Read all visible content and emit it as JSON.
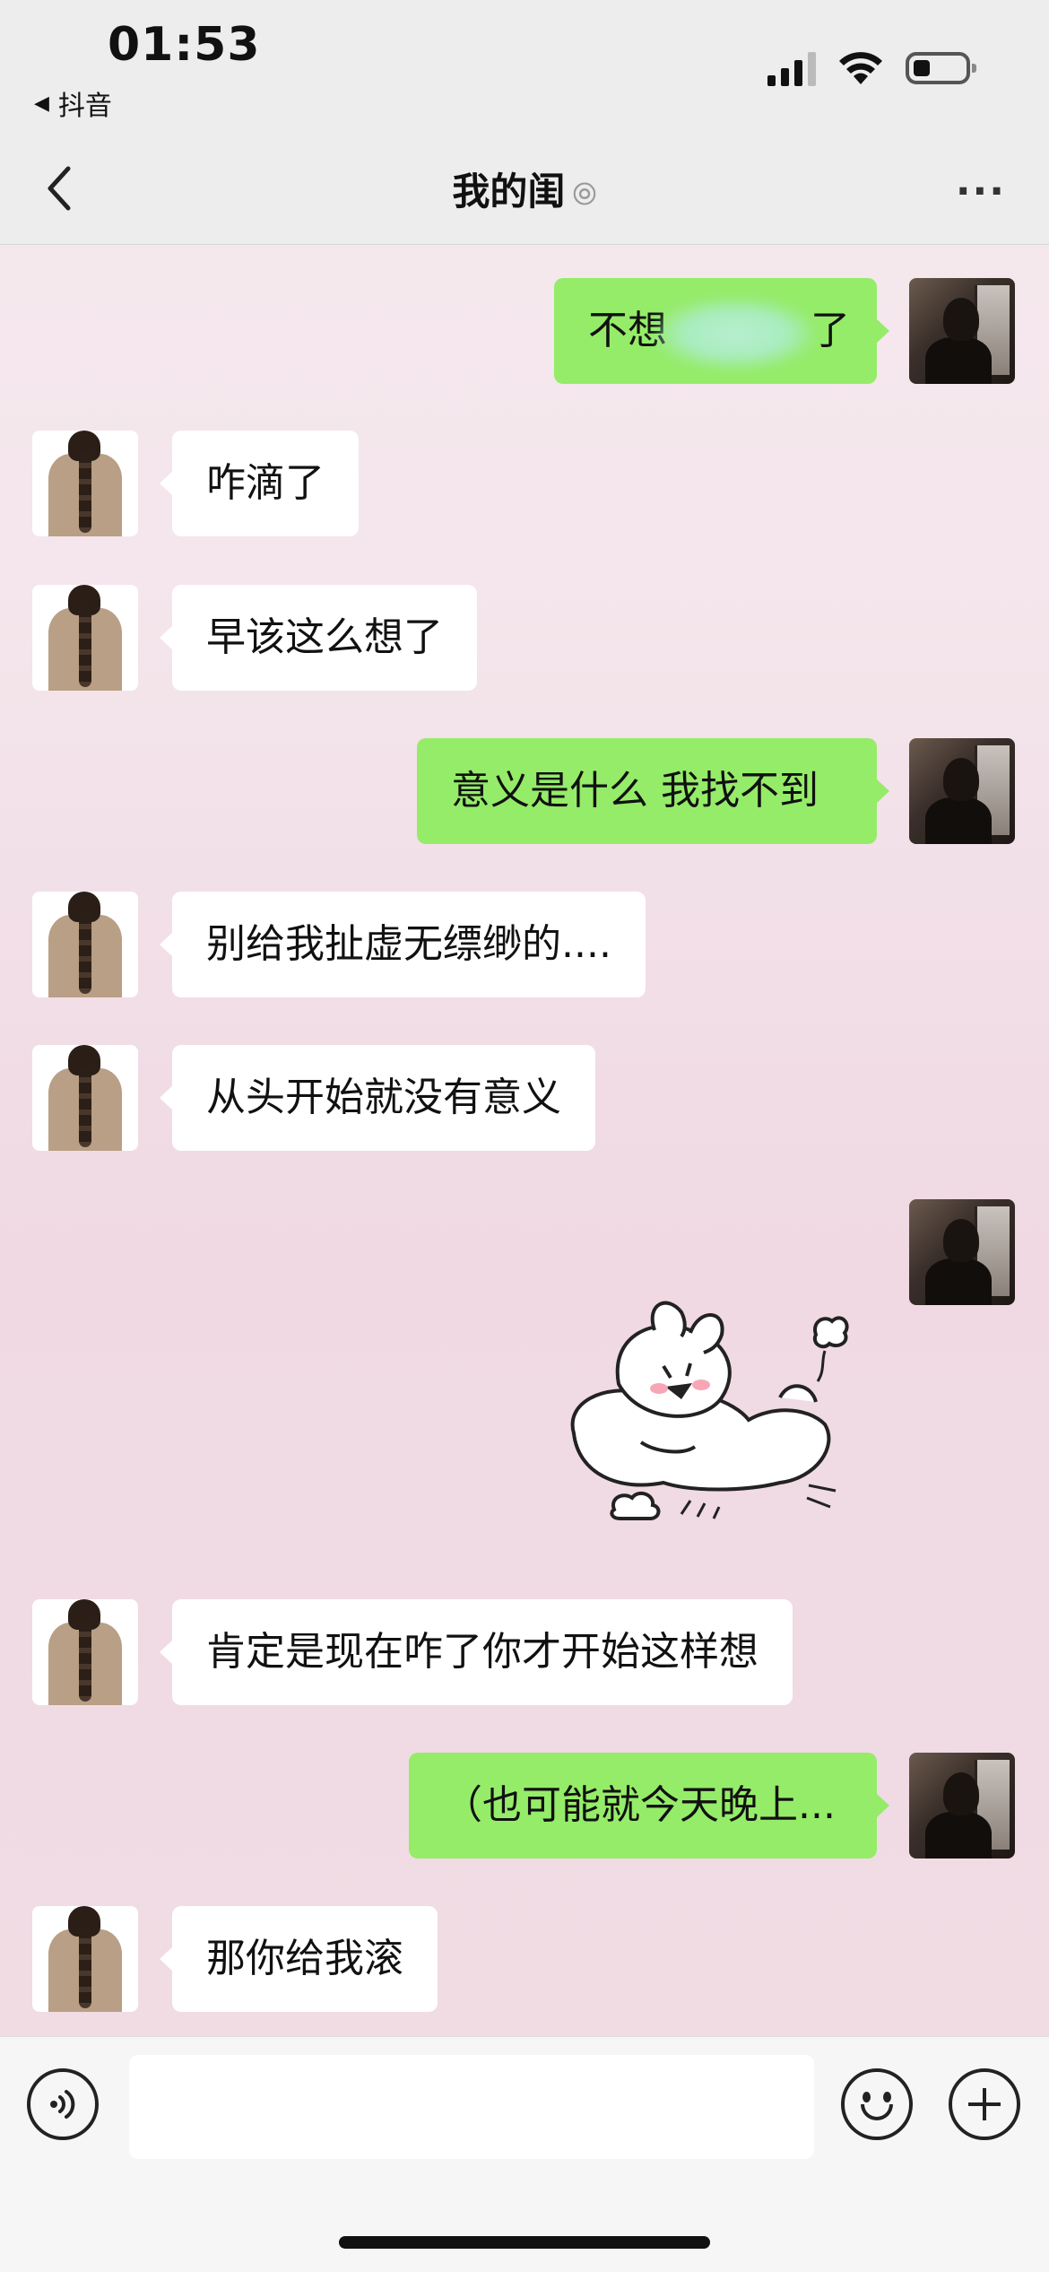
{
  "status_bar": {
    "time": "01:53",
    "back_app": "抖音",
    "back_arrow": "◀"
  },
  "nav": {
    "title": "我的闺",
    "ear_icon": "ear-icon",
    "more_label": "···"
  },
  "messages": [
    {
      "side": "right",
      "text": "不想",
      "tail": "了",
      "redacted": true
    },
    {
      "side": "left",
      "text": "咋滴了"
    },
    {
      "side": "left",
      "text": "早该这么想了"
    },
    {
      "side": "right",
      "text": "意义是什么 我找不到"
    },
    {
      "side": "left",
      "text": "别给我扯虚无缥缈的...."
    },
    {
      "side": "left",
      "text": "从头开始就没有意义"
    },
    {
      "side": "right",
      "type": "sticker",
      "sticker": "sleeping-bunny-sticker"
    },
    {
      "side": "left",
      "text": "肯定是现在咋了你才开始这样想"
    },
    {
      "side": "right",
      "text": "（也可能就今天晚上..."
    },
    {
      "side": "left",
      "text": "那你给我滚"
    }
  ],
  "input_bar": {
    "placeholder": "",
    "icons": [
      "voice-icon",
      "emoji-icon",
      "plus-icon"
    ]
  },
  "colors": {
    "bubble_me": "#95ec69",
    "bubble_friend": "#ffffff",
    "background": "#f3e3ea"
  }
}
